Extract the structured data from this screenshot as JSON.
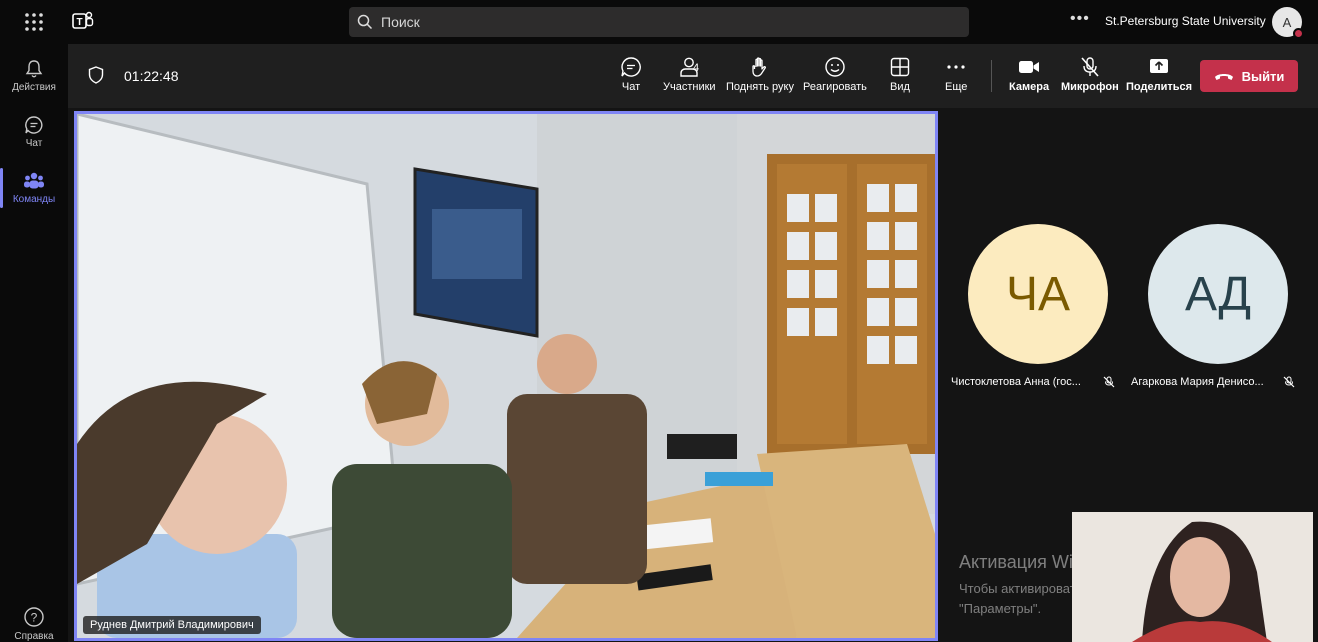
{
  "topbar": {
    "search_placeholder": "Поиск",
    "org_name": "St.Petersburg State University",
    "avatar_initial": "A",
    "more_icon": "more-horizontal-icon"
  },
  "rail": {
    "items": [
      {
        "label": "Действия",
        "icon": "bell-icon"
      },
      {
        "label": "Чат",
        "icon": "chat-icon"
      },
      {
        "label": "Команды",
        "icon": "teams-icon"
      },
      {
        "label": "Справка",
        "icon": "help-icon"
      }
    ]
  },
  "meeting": {
    "timer": "01:22:48",
    "participants_count": "4",
    "buttons": {
      "chat": "Чат",
      "participants": "Участники",
      "raise_hand": "Поднять руку",
      "react": "Реагировать",
      "view": "Вид",
      "more": "Еще",
      "camera": "Камера",
      "mic": "Микрофон",
      "share": "Поделиться",
      "leave": "Выйти"
    }
  },
  "stage": {
    "main_speaker": "Руднев Дмитрий Владимирович",
    "participants": [
      {
        "initials": "ЧА",
        "name": "Чистоклетова Анна (гос...",
        "bg": "#fcebbf",
        "fg": "#7a5a00"
      },
      {
        "initials": "АД",
        "name": "Агаркова Мария Денисо...",
        "bg": "#dde8ec",
        "fg": "#28424c"
      }
    ],
    "watermark_title": "Активация Windows",
    "watermark_text": "Чтобы активировать Windows, перейдите в раздел \"Параметры\"."
  },
  "colors": {
    "accent": "#7f85f5",
    "leave": "#c4314b",
    "toolbar_bg": "#1f1f1f"
  }
}
